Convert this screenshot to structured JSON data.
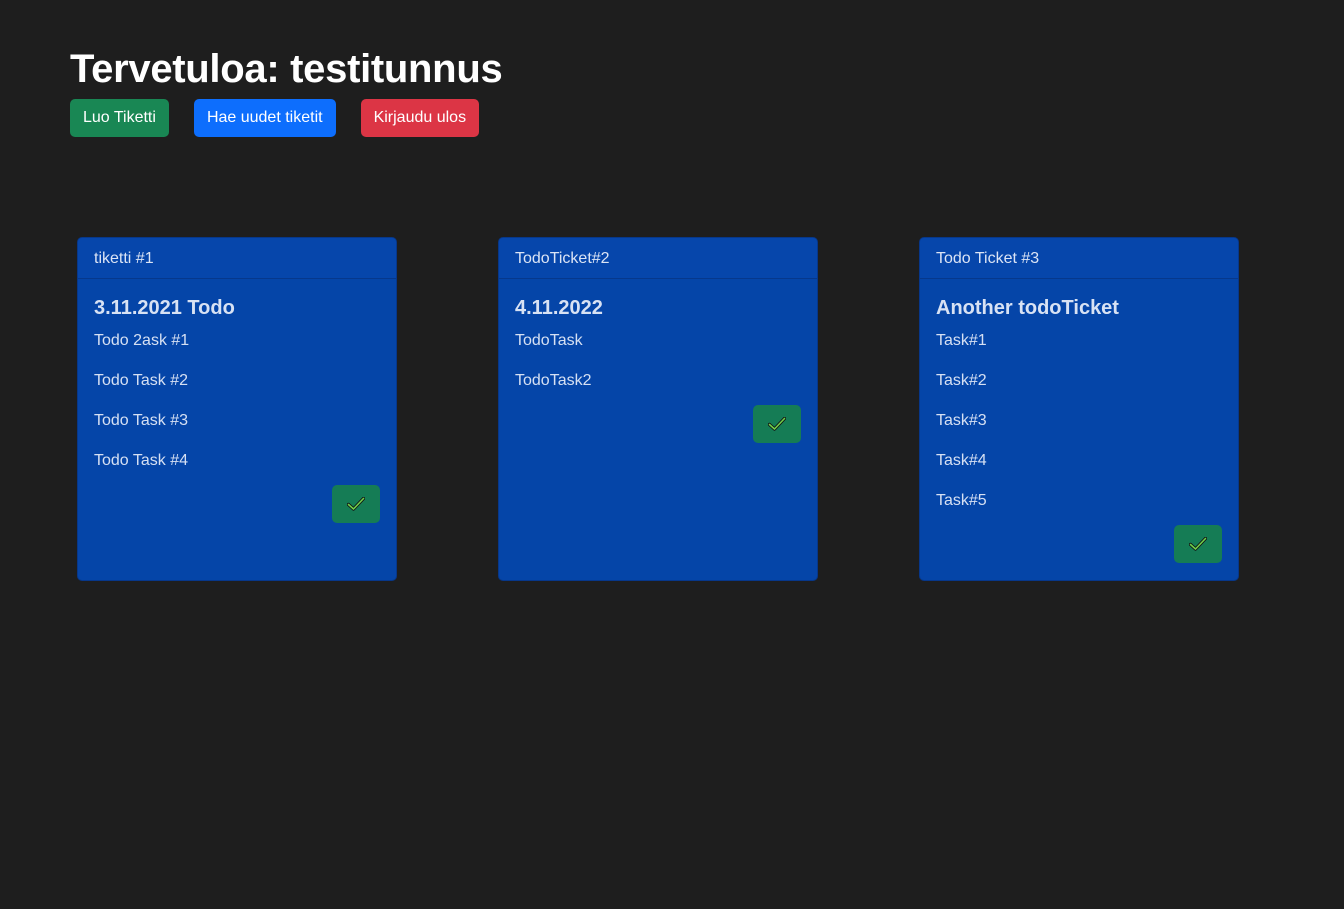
{
  "header": {
    "welcome": "Tervetuloa: testitunnus"
  },
  "buttons": {
    "create": "Luo Tiketti",
    "fetch": "Hae uudet tiketit",
    "logout": "Kirjaudu ulos"
  },
  "colors": {
    "create_button": "#198754",
    "fetch_button": "#0d6efd",
    "logout_button": "#dc3545",
    "card_background": "#0545a8",
    "done_button": "#157c55",
    "page_background": "#1e1e1e"
  },
  "tickets": [
    {
      "header": "tiketti #1",
      "title": "3.11.2021 Todo",
      "tasks": [
        "Todo 2ask #1",
        "Todo Task #2",
        "Todo Task #3",
        "Todo Task #4"
      ],
      "done_icon": "checkmark-icon"
    },
    {
      "header": "TodoTicket#2",
      "title": "4.11.2022",
      "tasks": [
        "TodoTask",
        "TodoTask2"
      ],
      "done_icon": "checkmark-icon"
    },
    {
      "header": "Todo Ticket #3",
      "title": "Another todoTicket",
      "tasks": [
        "Task#1",
        "Task#2",
        "Task#3",
        "Task#4",
        "Task#5"
      ],
      "done_icon": "checkmark-icon"
    }
  ]
}
